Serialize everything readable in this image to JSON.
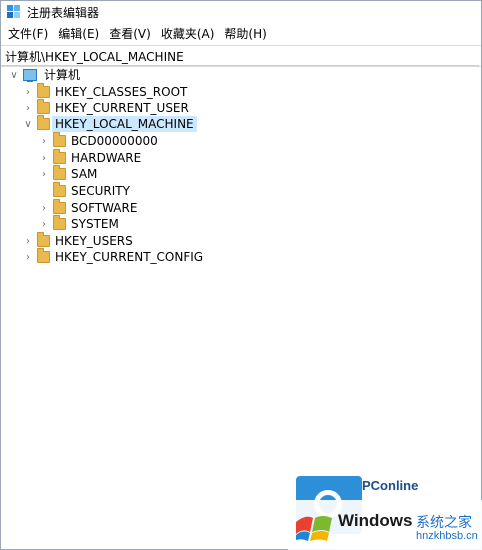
{
  "window": {
    "title": "注册表编辑器"
  },
  "menu": {
    "items": [
      {
        "label": "文件(F)"
      },
      {
        "label": "编辑(E)"
      },
      {
        "label": "查看(V)"
      },
      {
        "label": "收藏夹(A)"
      },
      {
        "label": "帮助(H)"
      }
    ]
  },
  "address": {
    "path": "计算机\\HKEY_LOCAL_MACHINE"
  },
  "tree": {
    "root": {
      "label": "计算机"
    },
    "hives": [
      {
        "label": "HKEY_CLASSES_ROOT"
      },
      {
        "label": "HKEY_CURRENT_USER"
      },
      {
        "label": "HKEY_LOCAL_MACHINE"
      },
      {
        "label": "HKEY_USERS"
      },
      {
        "label": "HKEY_CURRENT_CONFIG"
      }
    ],
    "hklm_children": [
      {
        "label": "BCD00000000"
      },
      {
        "label": "HARDWARE"
      },
      {
        "label": "SAM"
      },
      {
        "label": "SECURITY"
      },
      {
        "label": "SOFTWARE"
      },
      {
        "label": "SYSTEM"
      }
    ]
  },
  "watermark": {
    "brand": "PConline",
    "windows_text": "Windows",
    "site_cn": "系统之家",
    "site_url": "hnzkhbsb.cn"
  },
  "colors": {
    "selection": "#cce8ff",
    "folder": "#e9b94d",
    "accent": "#2e8fd9"
  }
}
